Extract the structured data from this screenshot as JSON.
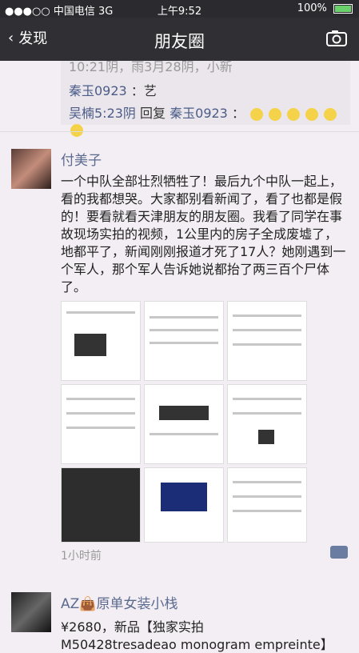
{
  "status": {
    "carrier": "●●●○○ 中国电信 3G",
    "time": "上午9:52",
    "battery": "100%"
  },
  "nav": {
    "back": "发现",
    "title": "朋友圈"
  },
  "previous_post": {
    "meta": "10:21阴，雨3月28阴，小新",
    "comments": [
      {
        "author": "秦玉0923",
        "text": "：艺"
      },
      {
        "author": "吴楠5:23阴",
        "middle": "回复",
        "target": "秦玉0923",
        "text": "："
      }
    ]
  },
  "post": {
    "author": "付美子",
    "body": "一个中队全部壮烈牺牲了！最后九个中队一起上，看的我都想哭。大家都别看新闻了，看了也都是假的！要看就看天津朋友的朋友圈。我看了同学在事故现场实拍的视频，1公里内的房子全成废墟了，地都平了，新闻刚刚报道才死了17人？她刚遇到一个军人，那个军人告诉她说都抬了两三百个尸体了。",
    "time": "1小时前"
  },
  "next_post": {
    "author": "AZ👜原单女装小栈",
    "line1": "¥2680，新品【独家实拍",
    "line2": "M50428tresadeao monogram empreinte】"
  }
}
